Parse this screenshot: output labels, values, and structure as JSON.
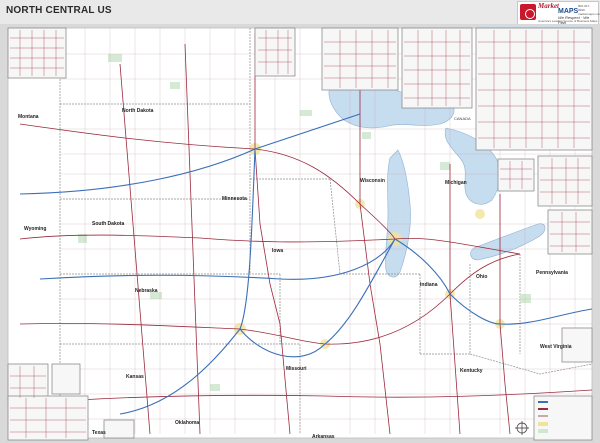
{
  "title": "NORTH CENTRAL US",
  "logo": {
    "brand_line1": "Market",
    "brand_line2": "MAPS",
    "tagline": "We Respect · We Plan",
    "subtitle": "America's Leading Source of Business Maps",
    "side_text": "800-327-9999 · marketmaps.com"
  },
  "labels": {
    "montana": "Montana",
    "north_dakota": "North Dakota",
    "south_dakota": "South Dakota",
    "wyoming": "Wyoming",
    "nebraska": "Nebraska",
    "kansas": "Kansas",
    "minnesota": "Minnesota",
    "wisconsin": "Wisconsin",
    "iowa": "Iowa",
    "michigan": "Michigan",
    "missouri": "Missouri",
    "indiana": "Indiana",
    "ohio": "Ohio",
    "pennsylvania": "Pennsylvania",
    "west_virginia": "West Virginia",
    "kentucky": "Kentucky",
    "oklahoma": "Oklahoma",
    "arkansas": "Arkansas",
    "texas": "Texas",
    "canada": "CANADA"
  },
  "colors": {
    "land": "#ffffff",
    "outside": "#d9d9d9",
    "water": "#c6dcef",
    "roads": "#9b2a3c",
    "interstate": "#3b6fb8",
    "urban": "#f3e29a",
    "parks": "#cfe8cf"
  }
}
